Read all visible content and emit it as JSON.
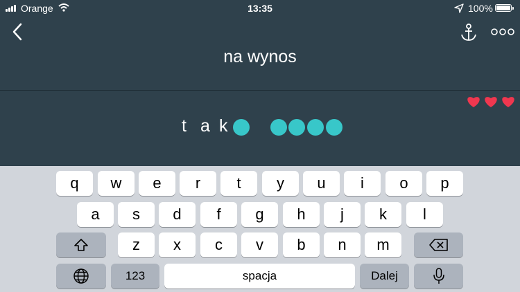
{
  "status_bar": {
    "carrier": "Orange",
    "time": "13:35",
    "battery": "100%"
  },
  "header": {
    "title": "na wynos"
  },
  "hearts": 3,
  "answer": {
    "letters": [
      "t",
      "a",
      "k"
    ]
  },
  "keyboard": {
    "row1": [
      "q",
      "w",
      "e",
      "r",
      "t",
      "y",
      "u",
      "i",
      "o",
      "p"
    ],
    "row2": [
      "a",
      "s",
      "d",
      "f",
      "g",
      "h",
      "j",
      "k",
      "l"
    ],
    "row3": [
      "z",
      "x",
      "c",
      "v",
      "b",
      "n",
      "m"
    ],
    "numbers_label": "123",
    "space_label": "spacja",
    "return_label": "Dalej"
  },
  "colors": {
    "background": "#2f414c",
    "accent": "#38c7c9",
    "heart": "#f0374f"
  }
}
